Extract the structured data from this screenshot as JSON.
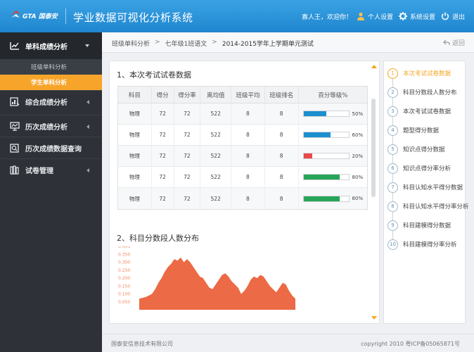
{
  "header": {
    "logo_text": "GTA 国泰安",
    "app_title": "学业数据可视化分析系统",
    "welcome": "寡人王，欢迎你！",
    "personal_settings": "个人设置",
    "system_settings": "系统设置",
    "logout": "退出",
    "colors": {
      "bar": "#2a94dc",
      "logo_red": "#e8392b"
    }
  },
  "sidebar": {
    "main_active": "单科成绩分析",
    "sub_items": [
      "班级单科分析",
      "学生单科分析"
    ],
    "active_sub_index": 1,
    "items": [
      "综合成绩分析",
      "历次成绩分析",
      "历次成绩数据查询",
      "试卷管理"
    ],
    "colors": {
      "bg": "#2e3238",
      "active_sub": "#f7a52a"
    }
  },
  "breadcrumb": [
    "班级单科分析",
    "七年级1班语文",
    "2014-2015学年上学期单元测试"
  ],
  "back_label": "返回",
  "section1_title": "1、本次考试试卷数据",
  "table": {
    "headers": [
      "科目",
      "得分",
      "得分率",
      "离均值",
      "班级平均",
      "班级排名",
      "百分等级%"
    ],
    "rows": [
      {
        "subject": "物理",
        "score": "72",
        "rate": "72",
        "deviation": "522",
        "class_avg": "8",
        "class_rank": "8",
        "pct": 50,
        "pct_label": "50%",
        "color": "#1c8fcf"
      },
      {
        "subject": "物理",
        "score": "72",
        "rate": "72",
        "deviation": "522",
        "class_avg": "8",
        "class_rank": "8",
        "pct": 60,
        "pct_label": "60%",
        "color": "#1c8fcf"
      },
      {
        "subject": "物理",
        "score": "72",
        "rate": "72",
        "deviation": "522",
        "class_avg": "8",
        "class_rank": "8",
        "pct": 20,
        "pct_label": "20%",
        "color": "#e94a4a"
      },
      {
        "subject": "物理",
        "score": "72",
        "rate": "72",
        "deviation": "522",
        "class_avg": "8",
        "class_rank": "8",
        "pct": 80,
        "pct_label": "80%",
        "color": "#27a558"
      },
      {
        "subject": "物理",
        "score": "72",
        "rate": "72",
        "deviation": "522",
        "class_avg": "8",
        "class_rank": "8",
        "pct": 80,
        "pct_label": "80%",
        "color": "#27a558"
      }
    ]
  },
  "section2_title": "2、科目分数段人数分布",
  "chart_data": {
    "type": "area",
    "ylim": [
      0.0,
      0.4
    ],
    "yticks": [
      "0.400",
      "0.350",
      "0.300",
      "0.250",
      "0.200",
      "0.150",
      "0.100",
      "0.050"
    ],
    "color": "#ec6a45",
    "values": [
      0.07,
      0.075,
      0.08,
      0.09,
      0.1,
      0.13,
      0.17,
      0.2,
      0.24,
      0.27,
      0.29,
      0.32,
      0.31,
      0.33,
      0.3,
      0.32,
      0.3,
      0.27,
      0.24,
      0.21,
      0.2,
      0.17,
      0.14,
      0.13,
      0.16,
      0.19,
      0.22,
      0.23,
      0.21,
      0.18,
      0.16,
      0.14,
      0.1,
      0.12,
      0.15,
      0.19,
      0.21,
      0.2,
      0.22,
      0.21,
      0.18,
      0.15,
      0.13,
      0.11,
      0.14,
      0.17,
      0.16,
      0.12,
      0.09,
      0.07
    ]
  },
  "steps": [
    "本次考试试卷数据",
    "科目分数段人数分布",
    "本次考试试卷数据",
    "题型得分数据",
    "知识点得分数据",
    "知识点得分率分析",
    "科目认知水平得分数据",
    "科目认知水平得分率分析",
    "科目建模得分数据",
    "科目建模得分率分析"
  ],
  "active_step": 0,
  "footer": {
    "company": "国泰安信息技术有限公司",
    "copyright": "copyright 2010 粤ICP备05065871号"
  }
}
